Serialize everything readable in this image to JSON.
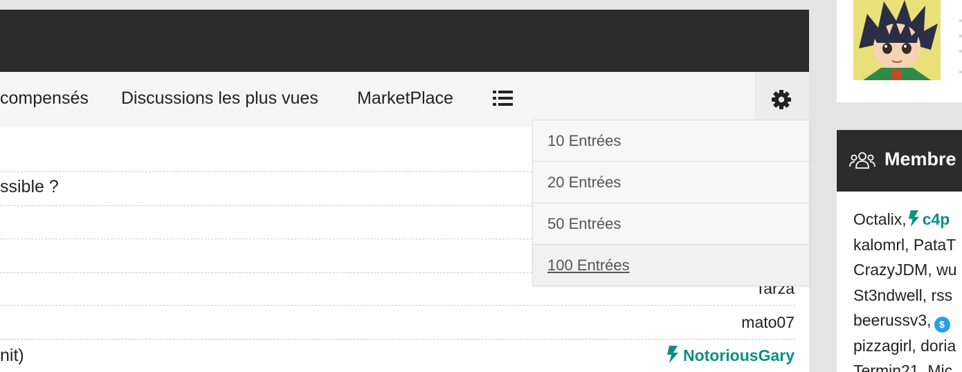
{
  "nav": {
    "items": [
      {
        "label": "compensés"
      },
      {
        "label": "Discussions les plus vues"
      },
      {
        "label": "MarketPlace"
      }
    ]
  },
  "rows": [
    {
      "title": "",
      "author": ""
    },
    {
      "title": "ssible ?",
      "author": ""
    },
    {
      "title": "",
      "author": ""
    },
    {
      "title": "",
      "author": "Tarza"
    },
    {
      "title": "",
      "author": "mato07"
    },
    {
      "title": "nit)",
      "author": "NotoriousGary"
    }
  ],
  "dropdown": {
    "items": [
      {
        "label": "10 Entrées"
      },
      {
        "label": "20 Entrées"
      },
      {
        "label": "50 Entrées"
      },
      {
        "label": "100 Entrées"
      }
    ]
  },
  "sidebar": {
    "members_title": "Membre",
    "members": {
      "line1_a": "Octalix,",
      "line1_b": "c4p",
      "line2": "kalomrl, PataT",
      "line3": "CrazyJDM, wu",
      "line4": "St3ndwell, rss",
      "line5": "beerussv3,",
      "line6": "pizzagirl, doria",
      "line7": "Termin21, Mic"
    },
    "badge_symbol": "$"
  },
  "icons": {
    "gear": "gear-icon",
    "list": "list-icon",
    "members": "users-icon",
    "bolt": "lightning-bolt-icon",
    "badge": "dollar-badge-icon"
  },
  "colors": {
    "accent": "#0d8f80",
    "header_dark": "#2c2c2c",
    "badge_blue": "#2a9ee8"
  }
}
